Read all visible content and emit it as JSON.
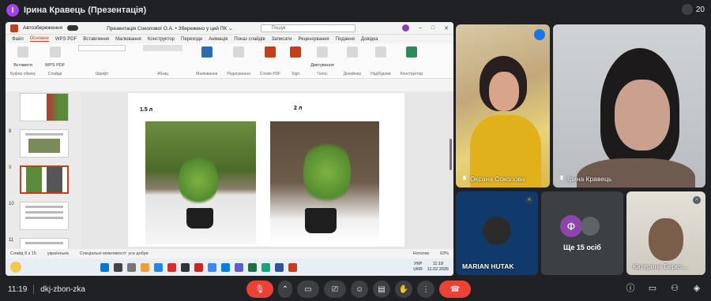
{
  "topbar": {
    "presenter_initial": "І",
    "presenter_title": "Ірина Кравець (Презентація)",
    "participant_count": "20"
  },
  "ppt": {
    "autosave_label": "Автозбереження",
    "file_title": "Презентація Соколової О.А. • Збережено у цей ПК ⌄",
    "search_placeholder": "Пошук",
    "user_initials": "PS",
    "tabs": [
      "Файл",
      "Основне",
      "WPS PDF",
      "Вставлення",
      "Малювання",
      "Конструктор",
      "Переходи",
      "Анімація",
      "Показ слайдів",
      "Записати",
      "Рецензування",
      "Подання",
      "Довідка"
    ],
    "ribbon_groups": [
      "Буфер обміну",
      "Слайди",
      "Шрифт",
      "Абзац",
      "Малювання",
      "Редагування",
      "Create PDF",
      "Sign",
      "Голос",
      "Дизайнер",
      "Надбудови",
      "Конструктор"
    ],
    "ribbon_sub": [
      "Вставити",
      "WPS PDF",
      "Диктування",
      "Надбудови"
    ],
    "slide_labels": [
      "1.5 л",
      "2 л"
    ],
    "thumb_numbers": [
      "8",
      "9",
      "10",
      "11"
    ],
    "status_left": "Слайд 9 з 15",
    "status_lang": "українська",
    "status_access": "Спеціальні можливості: усе добре",
    "status_notes": "Нотатки",
    "status_zoom": "63%",
    "taskbar_lang": "УКР",
    "taskbar_lang2": "UKR",
    "taskbar_time": "11:19",
    "taskbar_date": "11.02.2026"
  },
  "tiles": [
    {
      "name": "Оксана Соколова"
    },
    {
      "name": "Ірина Кравець"
    },
    {
      "name": "MARIAN HUTAK"
    },
    {
      "name": "Ще 15 осіб",
      "initial": "Ф"
    },
    {
      "name": "Катерина Берез..."
    }
  ],
  "bottombar": {
    "time": "11:19",
    "meeting_code": "dkj-zbon-zka"
  },
  "colors": {
    "accent": "#c43e1c",
    "end_call": "#ea4335",
    "meet_bg": "#202124",
    "speaking": "#1a73e8"
  },
  "icons": [
    "mic-off-icon",
    "camera-icon",
    "present-icon",
    "emoji-icon",
    "captions-icon",
    "raise-hand-icon",
    "more-icon",
    "end-call-icon",
    "info-icon",
    "chat-icon",
    "people-icon",
    "activities-icon"
  ]
}
